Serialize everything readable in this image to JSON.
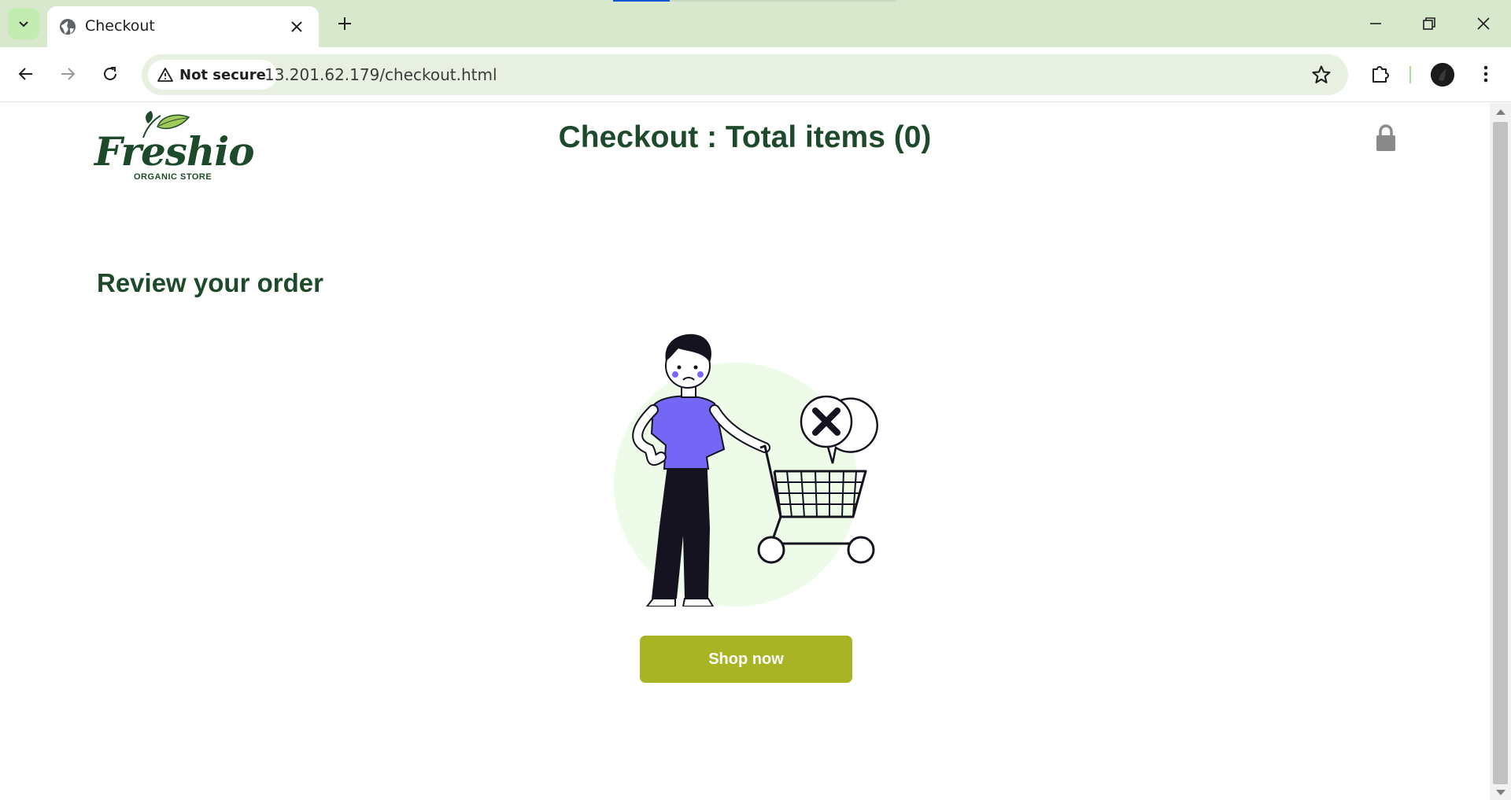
{
  "browser": {
    "tab": {
      "title": "Checkout",
      "favicon": "globe-icon"
    },
    "address_bar": {
      "security_label": "Not secure",
      "url": "13.201.62.179/checkout.html"
    },
    "icons": {
      "tab_search": "chevron-down-icon",
      "tab_close": "close-icon",
      "new_tab": "plus-icon",
      "minimize": "minimize-icon",
      "restore": "restore-icon",
      "close": "close-icon",
      "back": "arrow-left-icon",
      "forward": "arrow-right-icon",
      "reload": "reload-icon",
      "warning": "warning-icon",
      "bookmark": "star-icon",
      "extensions": "puzzle-icon",
      "menu": "kebab-menu-icon"
    },
    "colors": {
      "chrome_bg": "#d7e8cd",
      "omnibox_bg": "#e8f0e1"
    }
  },
  "page": {
    "logo": {
      "name": "Freshio",
      "tagline": "ORGANIC STORE"
    },
    "header": {
      "title": "Checkout : Total items (0)",
      "cart_icon": "lock-icon"
    },
    "section_heading": "Review your order",
    "empty_state": {
      "illustration": "empty-cart-illustration"
    },
    "cta": {
      "label": "Shop now"
    },
    "colors": {
      "brand_green": "#1e4a2c",
      "button": "#a8b423",
      "illustration_accent": "#7566f5",
      "illustration_bg": "#eefbe8"
    }
  }
}
